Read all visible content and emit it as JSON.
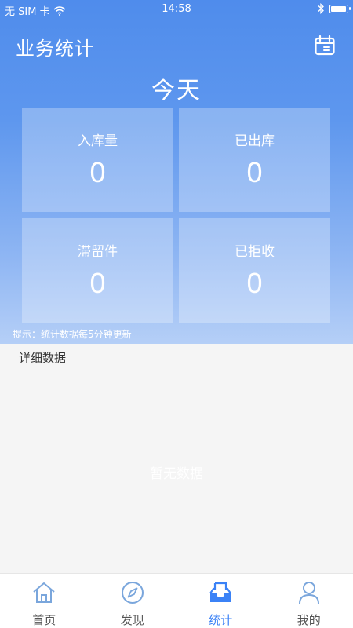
{
  "status_bar": {
    "carrier": "无 SIM 卡",
    "time": "14:58",
    "battery_level": 0.95
  },
  "header": {
    "title": "业务统计",
    "calendar_icon": "calendar-icon"
  },
  "period": {
    "title": "今天"
  },
  "stats": [
    {
      "label": "入库量",
      "value": "0"
    },
    {
      "label": "已出库",
      "value": "0"
    },
    {
      "label": "滞留件",
      "value": "0"
    },
    {
      "label": "已拒收",
      "value": "0"
    }
  ],
  "hint": "提示：统计数据每5分钟更新",
  "detail": {
    "title": "详细数据",
    "empty_text": "暂无数据"
  },
  "tabbar": {
    "active_index": 2,
    "active_color": "#3b82f6",
    "items": [
      {
        "label": "首页",
        "icon": "home-icon"
      },
      {
        "label": "发现",
        "icon": "compass-icon"
      },
      {
        "label": "统计",
        "icon": "inbox-icon"
      },
      {
        "label": "我的",
        "icon": "user-icon"
      }
    ]
  }
}
